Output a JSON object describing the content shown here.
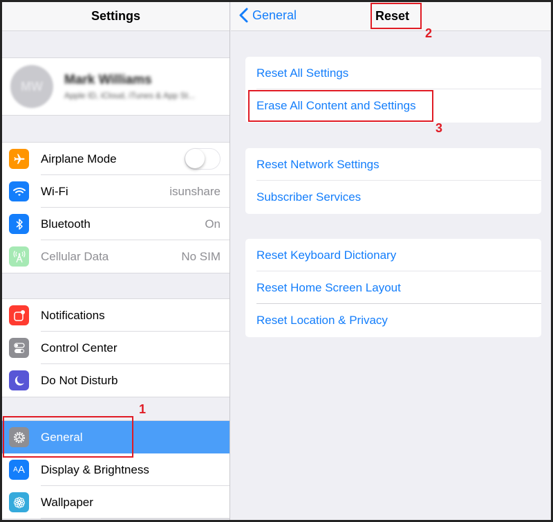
{
  "master": {
    "title": "Settings",
    "profile": {
      "initials": "MW",
      "name": "Mark Williams",
      "subtitle": "Apple ID, iCloud, iTunes & App St..."
    },
    "groups": [
      {
        "items": [
          {
            "label": "Airplane Mode",
            "icon": "airplane-icon",
            "icon_color": "#ff9500",
            "control": "toggle",
            "toggle_on": false
          },
          {
            "label": "Wi-Fi",
            "icon": "wifi-icon",
            "icon_color": "#147efb",
            "value": "isunshare"
          },
          {
            "label": "Bluetooth",
            "icon": "bluetooth-icon",
            "icon_color": "#147efb",
            "value": "On"
          },
          {
            "label": "Cellular Data",
            "icon": "cellular-icon",
            "icon_color": "#a6e9b4",
            "value": "No SIM",
            "disabled": true
          }
        ]
      },
      {
        "items": [
          {
            "label": "Notifications",
            "icon": "notifications-icon",
            "icon_color": "#ff3b30"
          },
          {
            "label": "Control Center",
            "icon": "control-center-icon",
            "icon_color": "#8e8e93"
          },
          {
            "label": "Do Not Disturb",
            "icon": "moon-icon",
            "icon_color": "#5856d6"
          }
        ]
      },
      {
        "items": [
          {
            "label": "General",
            "icon": "gear-icon",
            "icon_color": "#8e8e93",
            "selected": true
          },
          {
            "label": "Display & Brightness",
            "icon": "display-icon",
            "icon_color": "#147efb"
          },
          {
            "label": "Wallpaper",
            "icon": "wallpaper-icon",
            "icon_color": "#35aadc"
          }
        ]
      }
    ]
  },
  "detail": {
    "back_label": "General",
    "title": "Reset",
    "groups": [
      {
        "items": [
          "Reset All Settings",
          "Erase All Content and Settings"
        ]
      },
      {
        "items": [
          "Reset Network Settings",
          "Subscriber Services"
        ]
      },
      {
        "items": [
          "Reset Keyboard Dictionary",
          "Reset Home Screen Layout",
          "Reset Location & Privacy"
        ]
      }
    ]
  },
  "annotations": {
    "step1": "1",
    "step2": "2",
    "step3": "3",
    "color": "#e01b24"
  },
  "colors": {
    "accent": "#147efb",
    "selected_row": "#4b9ef9",
    "background": "#efeff4"
  }
}
